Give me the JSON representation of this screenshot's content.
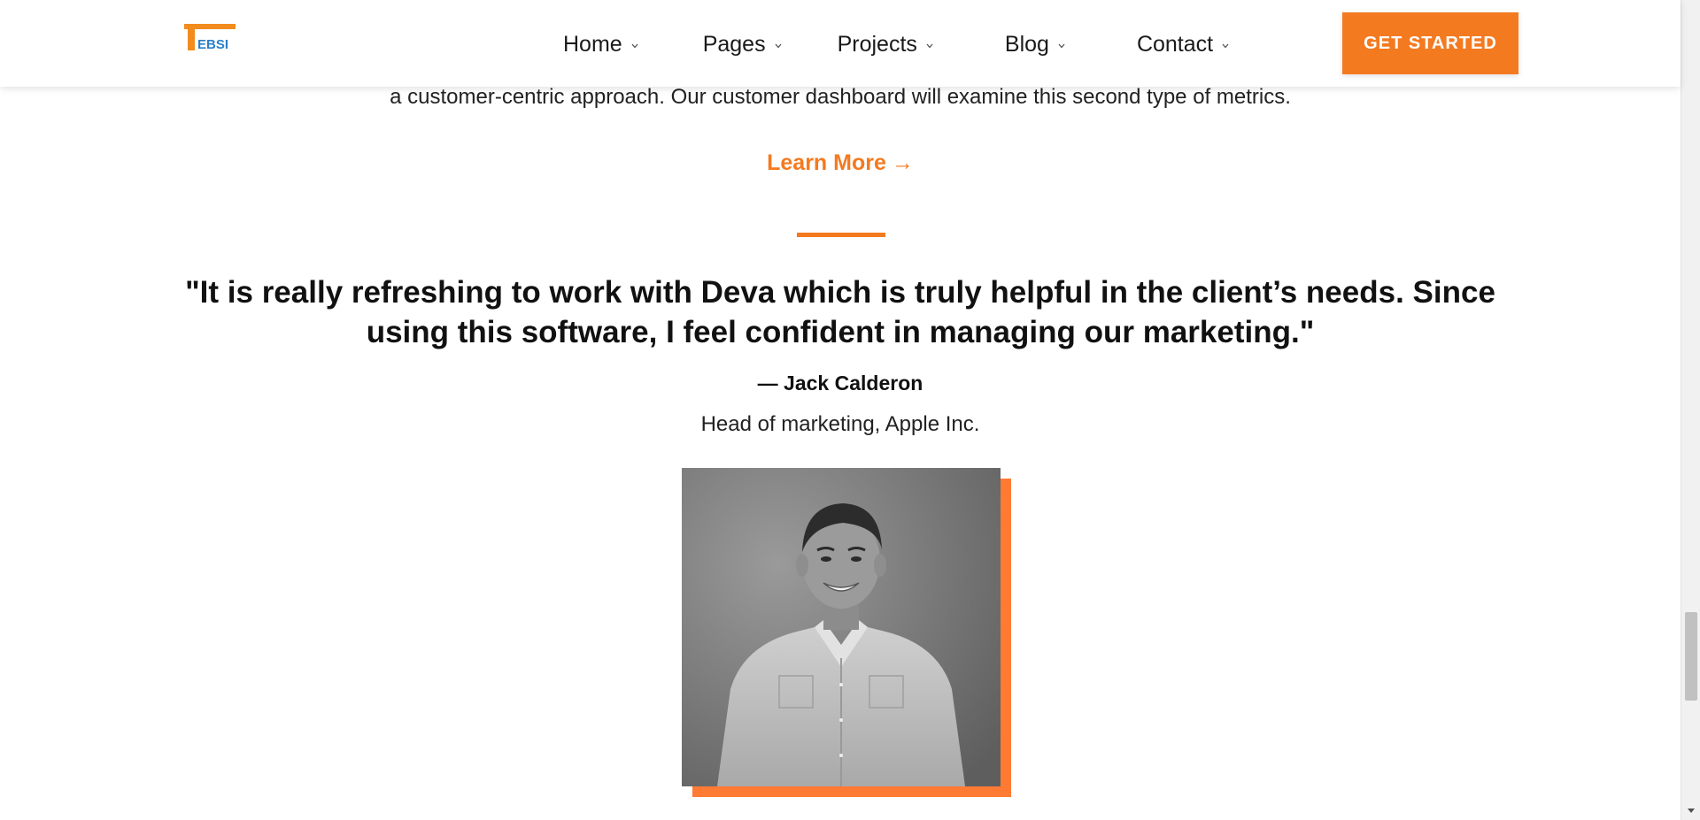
{
  "brand": {
    "logo_text": "TEBSI",
    "accent_color": "#f47a20",
    "logo_blue": "#2a7fc9"
  },
  "nav": {
    "items": [
      {
        "label": "Home",
        "icon": "chevron-down-icon"
      },
      {
        "label": "Pages",
        "icon": "chevron-down-icon"
      },
      {
        "label": "Projects",
        "icon": "chevron-down-icon"
      },
      {
        "label": "Blog",
        "icon": "chevron-down-icon"
      },
      {
        "label": "Contact",
        "icon": "chevron-down-icon"
      }
    ],
    "cta_label": "GET STARTED"
  },
  "content": {
    "intro_text": "a customer-centric approach. Our customer dashboard will examine this second type of metrics.",
    "learn_more_label": "Learn More",
    "learn_more_icon": "arrow-right-icon"
  },
  "testimonial": {
    "quote": "\"It is really refreshing to work with Deva which is truly helpful in the client’s needs. Since using this software, I feel confident in managing our marketing.\"",
    "author": "— Jack Calderon",
    "role": "Head of marketing, Apple Inc.",
    "photo_icon": "person-photo",
    "photo_frame_color": "#ff7a33"
  },
  "scrollbar": {
    "scroll_position": 0.86,
    "down_icon": "scroll-down-arrow-icon"
  }
}
